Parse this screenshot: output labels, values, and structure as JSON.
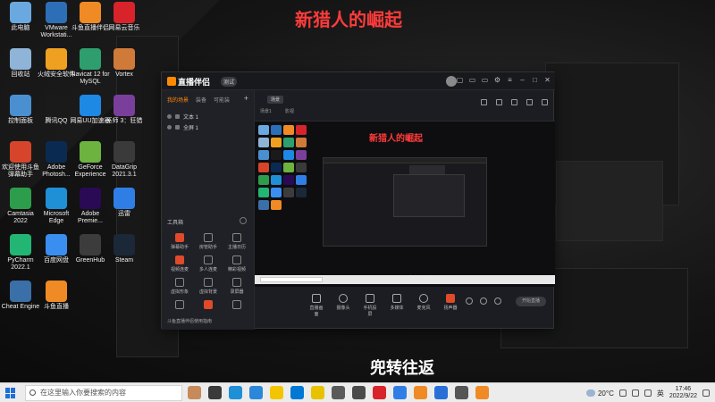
{
  "overlay": {
    "title": "新猎人的崛起",
    "caption": "兜转往返"
  },
  "desktop_icons": [
    {
      "label": "此电脑",
      "icon": "computer-icon",
      "color": "#6aa9e0"
    },
    {
      "label": "VMware Workstati...",
      "icon": "vmware-icon",
      "color": "#2d6fb6"
    },
    {
      "label": "斗鱼直播伴侣",
      "icon": "douyu-companion-icon",
      "color": "#f08a24"
    },
    {
      "label": "网易云音乐",
      "icon": "netease-music-icon",
      "color": "#d8232a"
    },
    {
      "label": "回收站",
      "icon": "recycle-bin-icon",
      "color": "#8fb4d8"
    },
    {
      "label": "火绒安全软件",
      "icon": "huorong-icon",
      "color": "#f0a020"
    },
    {
      "label": "Navicat 12 for MySQL",
      "icon": "navicat-icon",
      "color": "#2f9e6f"
    },
    {
      "label": "Vortex",
      "icon": "vortex-icon",
      "color": "#d07a3a"
    },
    {
      "label": "控制面板",
      "icon": "control-panel-icon",
      "color": "#4a90d0"
    },
    {
      "label": "腾讯QQ",
      "icon": "qq-icon",
      "color": "#1a1a1a"
    },
    {
      "label": "网易UU加速器",
      "icon": "uu-accelerator-icon",
      "color": "#1e88e5"
    },
    {
      "label": "巫师 3：狂猎",
      "icon": "witcher-icon",
      "color": "#7a3f9a"
    },
    {
      "label": "欢迎使用斗鱼弹幕助手",
      "icon": "danmaku-helper-icon",
      "color": "#d6452b"
    },
    {
      "label": "Adobe Photosh...",
      "icon": "photoshop-icon",
      "color": "#0a2a52"
    },
    {
      "label": "GeForce Experience",
      "icon": "geforce-icon",
      "color": "#6cb33f"
    },
    {
      "label": "DataGrip 2021.3.1",
      "icon": "datagrip-icon",
      "color": "#3a3a3a"
    },
    {
      "label": "Camtasia 2022",
      "icon": "camtasia-icon",
      "color": "#2d9d4c"
    },
    {
      "label": "Microsoft Edge",
      "icon": "edge-icon",
      "color": "#1f8fd6"
    },
    {
      "label": "Adobe Premie...",
      "icon": "premiere-icon",
      "color": "#2a0a55"
    },
    {
      "label": "迅雷",
      "icon": "xunlei-icon",
      "color": "#2f7ee6"
    },
    {
      "label": "PyCharm 2022.1",
      "icon": "pycharm-icon",
      "color": "#22b573"
    },
    {
      "label": "百度网盘",
      "icon": "baidu-netdisk-icon",
      "color": "#3a8ef0"
    },
    {
      "label": "GreenHub",
      "icon": "greenhub-icon",
      "color": "#3c3c3c"
    },
    {
      "label": "Steam",
      "icon": "steam-icon",
      "color": "#1b2838"
    },
    {
      "label": "Cheat Engine",
      "icon": "cheat-engine-icon",
      "color": "#3a6fa8"
    },
    {
      "label": "斗鱼直播",
      "icon": "douyu-icon",
      "color": "#f08a24"
    }
  ],
  "app": {
    "name": "直播伴侣",
    "version_badge": "测试",
    "sidebar_tabs": [
      "我的场景",
      "装备",
      "可能装"
    ],
    "layers": [
      "文本 1",
      "全屏 1"
    ],
    "tools_title": "工具箱",
    "tools": [
      "弹幕助手",
      "房管助手",
      "主播日历",
      "视频连麦",
      "多人连麦",
      "精彩视频",
      "虚拟形象",
      "虚拟背景",
      "录屏器",
      "",
      "",
      ""
    ],
    "notice": "斗鱼直播伴侣使用指南",
    "main_tag": "场景",
    "main_sub": "场景1",
    "main_sub2": "影视",
    "controls": [
      "直播画面",
      "摄像头",
      "手机投屏",
      "多媒体",
      "麦克风",
      "扬声器"
    ],
    "start_live": "开始直播"
  },
  "taskbar": {
    "search_placeholder": "在这里输入你要搜索的内容",
    "weather": "20°C",
    "ime": "英",
    "time": "17:46",
    "date": "2022/9/22"
  }
}
